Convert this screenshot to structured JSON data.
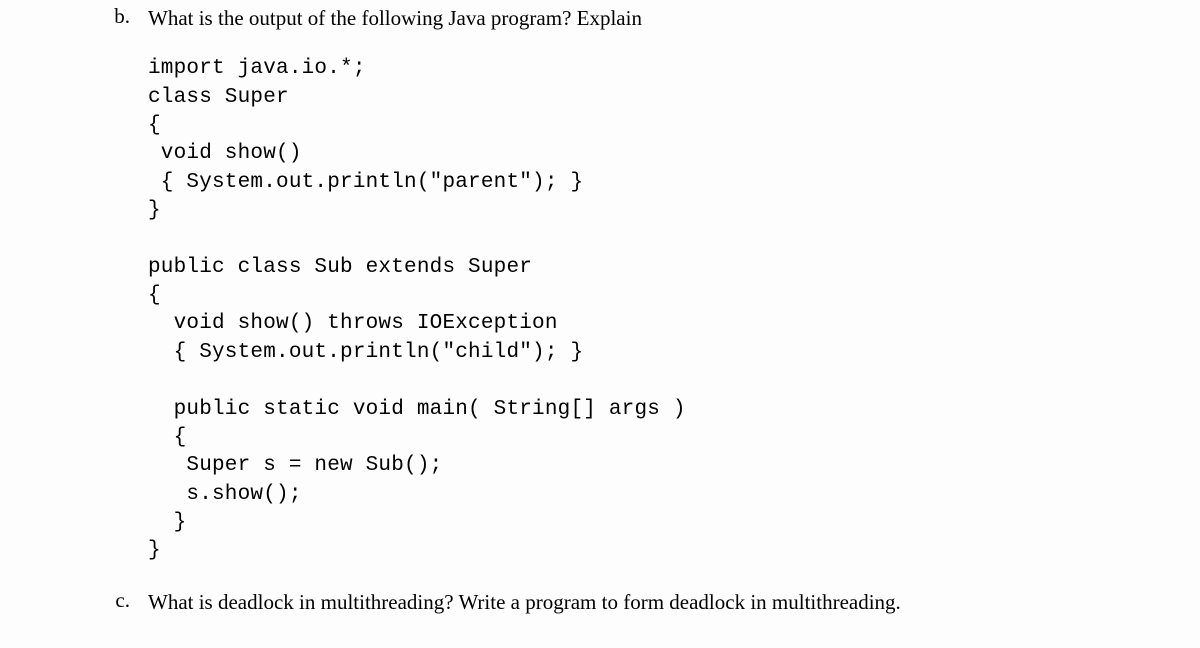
{
  "questions": {
    "b": {
      "label": "b.",
      "text": "What is the output of the following Java program? Explain",
      "code": "import java.io.*;\nclass Super\n{\n void show()\n { System.out.println(\"parent\"); }\n}\n\npublic class Sub extends Super\n{\n  void show() throws IOException\n  { System.out.println(\"child\"); }\n\n  public static void main( String[] args )\n  {\n   Super s = new Sub();\n   s.show();\n  }\n}"
    },
    "c": {
      "label": "c.",
      "text": "What is deadlock in multithreading? Write a program to form deadlock in multithreading."
    }
  }
}
